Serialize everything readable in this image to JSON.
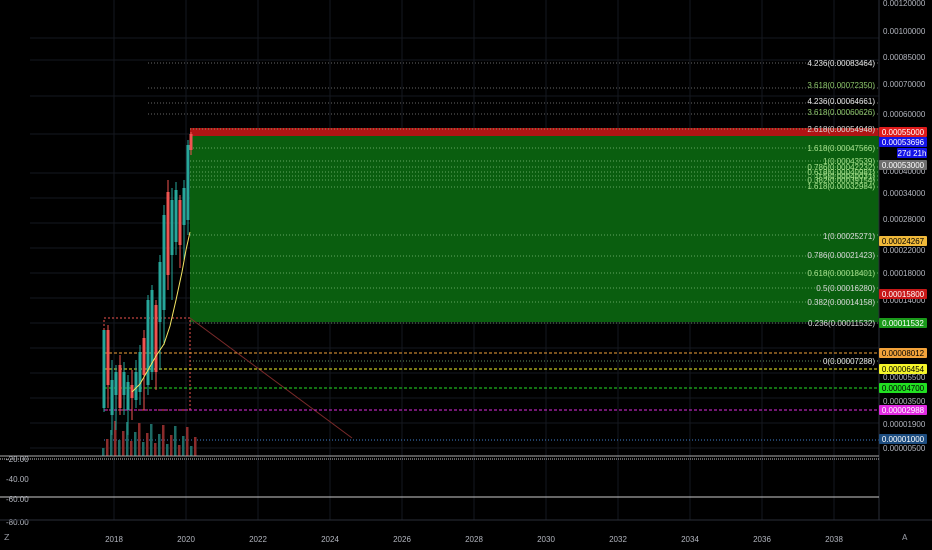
{
  "colors": {
    "background": "#000000",
    "grid": "#1c1f26",
    "up_candle": "#26a69a",
    "down_candle": "#ef5350",
    "zone_green": "#0b6e12",
    "zone_red": "#c41818",
    "ma_line": "#f5e663"
  },
  "corner_left": "Z",
  "corner_right": "A",
  "x_axis_labels": [
    "2018",
    "2020",
    "2022",
    "2024",
    "2026",
    "2028",
    "2030",
    "2032",
    "2034",
    "2036",
    "2038"
  ],
  "price_axis_labels": [
    "0.00120000",
    "0.00100000",
    "0.00085000",
    "0.00070000",
    "0.00060000",
    "0.00040000",
    "0.00034000",
    "0.00028000",
    "0.00022000",
    "0.00018000",
    "0.00014000",
    "0.00005500",
    "0.00003500",
    "0.00001900",
    "0.00000500"
  ],
  "price_axis_tags": [
    {
      "text": "0.00055000",
      "bg": "#e01b1b",
      "fg": "#ffffff"
    },
    {
      "text": "0.00053696",
      "bg": "#1414e6",
      "fg": "#ffffff"
    },
    {
      "text": "27d 21h",
      "bg": "#1414e6",
      "fg": "#ffffff"
    },
    {
      "text": "0.00053000",
      "bg": "#6e6e6e",
      "fg": "#ffffff"
    },
    {
      "text": "0.00024267",
      "bg": "#f0b93a",
      "fg": "#000000"
    },
    {
      "text": "0.00015800",
      "bg": "#c81818",
      "fg": "#ffffff"
    },
    {
      "text": "0.00011532",
      "bg": "#1a9a1a",
      "fg": "#ffffff"
    },
    {
      "text": "0.00008012",
      "bg": "#f2a23a",
      "fg": "#000000"
    },
    {
      "text": "0.00006454",
      "bg": "#f5f52a",
      "fg": "#000000"
    },
    {
      "text": "0.00004700",
      "bg": "#22e022",
      "fg": "#000000"
    },
    {
      "text": "0.00002988",
      "bg": "#e22ae2",
      "fg": "#ffffff"
    },
    {
      "text": "0.00001000",
      "bg": "#1d4d80",
      "fg": "#ffffff"
    }
  ],
  "fib_labels": [
    {
      "text": "4.236(0.00083464)",
      "color": "#e6e6e6"
    },
    {
      "text": "3.618(0.00072350)",
      "color": "#8cc56a"
    },
    {
      "text": "4.236(0.00064661)",
      "color": "#e6e6e6"
    },
    {
      "text": "3.618(0.00060626)",
      "color": "#8cc56a"
    },
    {
      "text": "2.618(0.00054948)",
      "color": "#d9d9d9"
    },
    {
      "text": "1.618(0.00047566)",
      "color": "#a5e08c"
    },
    {
      "text": "1(0.00043539)",
      "color": "#a5e08c"
    },
    {
      "text": "0.786(0.00042232)",
      "color": "#a5e08c"
    },
    {
      "text": "0.618(0.00040981)",
      "color": "#a5e08c"
    },
    {
      "text": "0.5(0.00040031)",
      "color": "#a5e08c"
    },
    {
      "text": "0.382(0.00039154)",
      "color": "#a5e08c"
    },
    {
      "text": "1.618(0.00032984)",
      "color": "#a5e08c"
    },
    {
      "text": "1(0.00025271)",
      "color": "#d9d9d9"
    },
    {
      "text": "0.786(0.00021423)",
      "color": "#d9d9d9"
    },
    {
      "text": "0.618(0.00018401)",
      "color": "#a5e08c"
    },
    {
      "text": "0.5(0.00016280)",
      "color": "#d9d9d9"
    },
    {
      "text": "0.382(0.00014158)",
      "color": "#d9d9d9"
    },
    {
      "text": "0.236(0.00011532)",
      "color": "#d9d9d9"
    },
    {
      "text": "0(0.00007288)",
      "color": "#e6e6e6"
    }
  ],
  "horizontal_levels": [
    {
      "name": "level-orange",
      "color": "#f2a23a",
      "price": "0.00008012"
    },
    {
      "name": "level-yellow",
      "color": "#f5f52a",
      "price": "0.00006454"
    },
    {
      "name": "level-green",
      "color": "#22e022",
      "price": "0.00004700"
    },
    {
      "name": "level-magenta",
      "color": "#e22ae2",
      "price": "0.00002988"
    },
    {
      "name": "level-blue",
      "color": "#3f7fd0",
      "price": "0.00001000"
    }
  ],
  "oscillator_axis_labels": [
    "-20.00",
    "-40.00",
    "-60.00",
    "-80.00"
  ]
}
